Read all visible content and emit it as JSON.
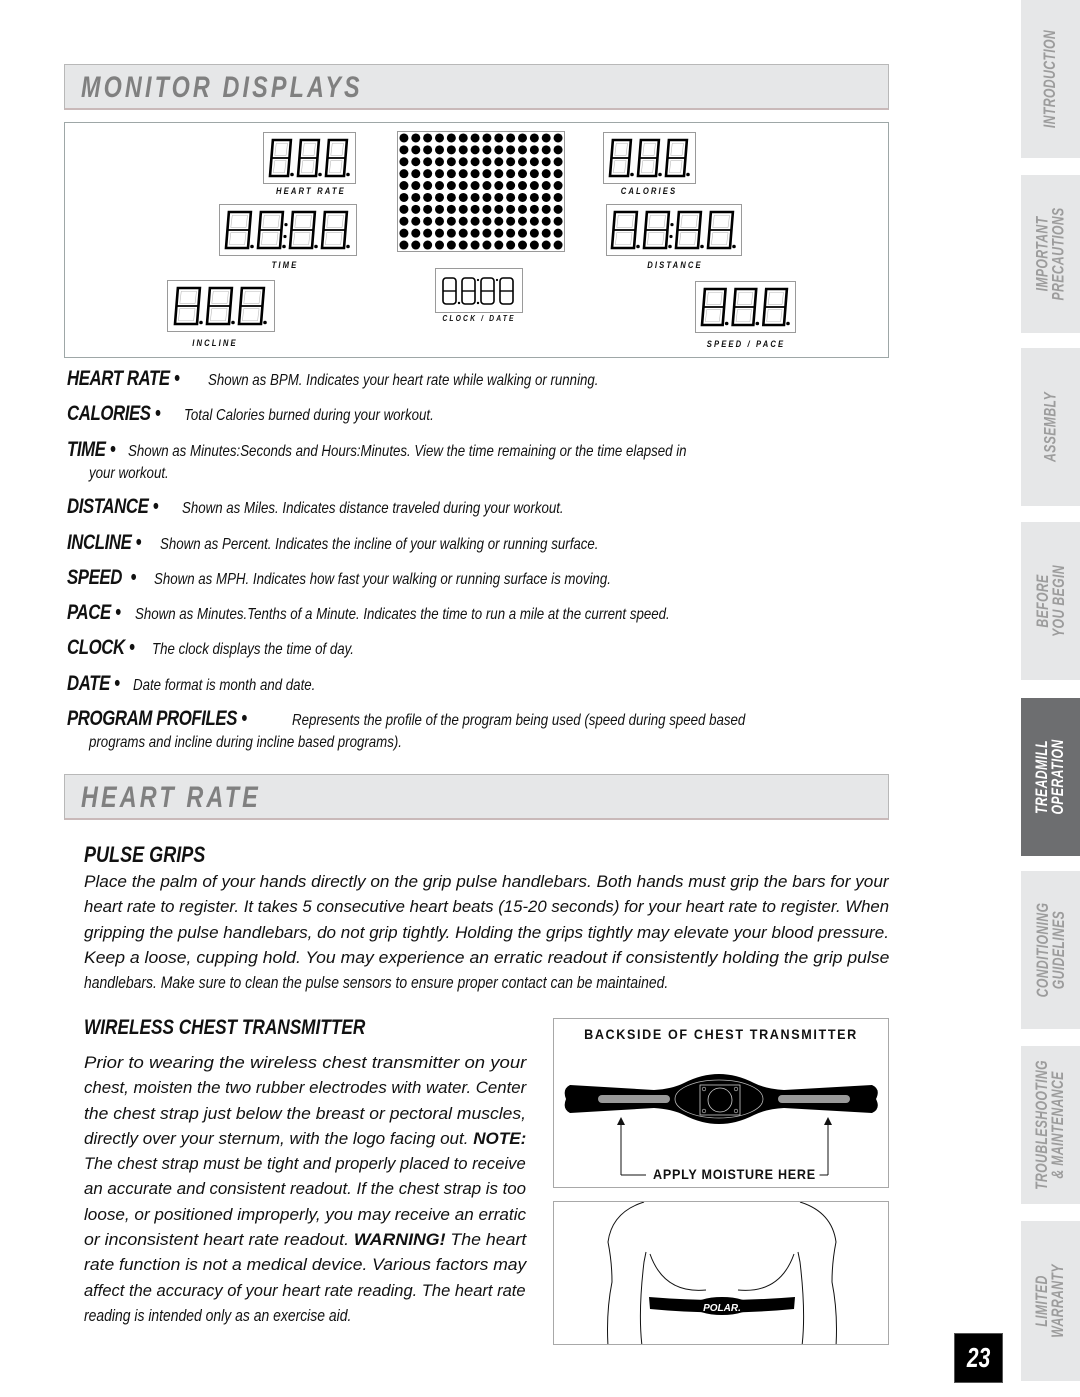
{
  "monitor_displays": {
    "title": "MONITOR DISPLAYS",
    "displays": [
      {
        "id": "heart-rate",
        "label": "HEART RATE",
        "readout": "8.8.8."
      },
      {
        "id": "calories",
        "label": "CALORIES",
        "readout": "8.8.8."
      },
      {
        "id": "time",
        "label": "TIME",
        "readout": "8.8:8.8."
      },
      {
        "id": "distance",
        "label": "DISTANCE",
        "readout": "8.8:8.8."
      },
      {
        "id": "incline",
        "label": "INCLINE",
        "readout": "8.8.8."
      },
      {
        "id": "clock-date",
        "label": "CLOCK / DATE",
        "readout": "8.8.8.8"
      },
      {
        "id": "speed-pace",
        "label": "SPEED / PACE",
        "readout": "8.8.8."
      }
    ],
    "program_profile_matrix": {
      "columns": 14,
      "rows": 10
    }
  },
  "definitions": [
    {
      "term": "HEART RATE",
      "bullet": "•",
      "desc": "Shown as BPM. Indicates your heart rate while walking or running.",
      "cont": ""
    },
    {
      "term": "CALORIES",
      "bullet": "•",
      "desc": "Total Calories burned during your workout.",
      "cont": ""
    },
    {
      "term": "TIME",
      "bullet": "•",
      "desc": "Shown as Minutes:Seconds and Hours:Minutes. View the time remaining or the time elapsed in",
      "cont": "your workout."
    },
    {
      "term": "DISTANCE",
      "bullet": "•",
      "desc": "Shown as Miles. Indicates distance traveled during your workout.",
      "cont": ""
    },
    {
      "term": "INCLINE",
      "bullet": "•",
      "desc": "Shown as Percent. Indicates the incline of your walking or running surface.",
      "cont": ""
    },
    {
      "term": "SPEED",
      "bullet": "•",
      "desc": "Shown as MPH. Indicates how fast your walking or running surface is moving.",
      "cont": ""
    },
    {
      "term": "PACE",
      "bullet": "•",
      "desc": "Shown as Minutes.Tenths of a Minute. Indicates the time to run a mile at the current speed.",
      "cont": ""
    },
    {
      "term": "CLOCK",
      "bullet": "•",
      "desc": "The clock displays the time of day.",
      "cont": ""
    },
    {
      "term": "DATE",
      "bullet": "•",
      "desc": "Date format is month and date.",
      "cont": ""
    },
    {
      "term": "PROGRAM PROFILES",
      "bullet": "•",
      "desc": "Represents the profile of the program being used (speed during speed based",
      "cont": "programs and incline during incline based programs)."
    }
  ],
  "heart_rate": {
    "title": "HEART RATE",
    "pulse_grips": {
      "heading": "PULSE GRIPS",
      "lines": [
        "Place the palm of your hands directly on the grip pulse handlebars. Both hands must grip the bars for your",
        "heart rate to register. It takes 5 consecutive heart beats (15-20 seconds) for your heart rate to register. When",
        "gripping the pulse handlebars, do not grip tightly. Holding the grips tightly may elevate your blood pressure.",
        "Keep a loose, cupping hold. You may experience an erratic readout if consistently holding the grip pulse",
        "handlebars. Make sure to clean the pulse sensors to ensure proper contact can be maintained."
      ]
    },
    "wireless": {
      "heading": "WIRELESS CHEST TRANSMITTER",
      "lines": [
        "Prior to wearing the wireless chest transmitter on your",
        "chest, moisten the two rubber electrodes with water. Center",
        "the chest strap just below the breast or pectoral muscles,",
        "directly over your sternum, with the logo facing out.",
        "The chest strap must be tight and properly placed to receive",
        "an accurate and consistent readout. If the chest strap is too",
        "loose, or positioned improperly, you may receive an erratic",
        "or inconsistent heart rate readout.",
        "rate function is not a medical device. Various factors may",
        "affect the accuracy of your heart rate reading. The heart rate",
        "reading is intended only as an exercise aid."
      ],
      "note_label": "NOTE:",
      "warning_label": "WARNING!",
      "warning_tail": "The heart"
    },
    "figure_transmitter": {
      "title": "BACKSIDE OF CHEST TRANSMITTER",
      "caption": "APPLY MOISTURE HERE"
    },
    "figure_body": {
      "logo": "POLAR."
    }
  },
  "side_tabs": [
    {
      "lines": [
        "INTRODUCTION"
      ],
      "active": false
    },
    {
      "lines": [
        "IMPORTANT",
        "PRECAUTIONS"
      ],
      "active": false
    },
    {
      "lines": [
        "ASSEMBLY"
      ],
      "active": false
    },
    {
      "lines": [
        "BEFORE",
        "YOU BEGIN"
      ],
      "active": false
    },
    {
      "lines": [
        "TREADMILL",
        "OPERATION"
      ],
      "active": true
    },
    {
      "lines": [
        "CONDITIONING",
        "GUIDELINES"
      ],
      "active": false
    },
    {
      "lines": [
        "TROUBLESHOOTING",
        "& MAINTENANCE"
      ],
      "active": false
    },
    {
      "lines": [
        "LIMITED",
        "WARRANTY"
      ],
      "active": false
    }
  ],
  "page_number": "23"
}
